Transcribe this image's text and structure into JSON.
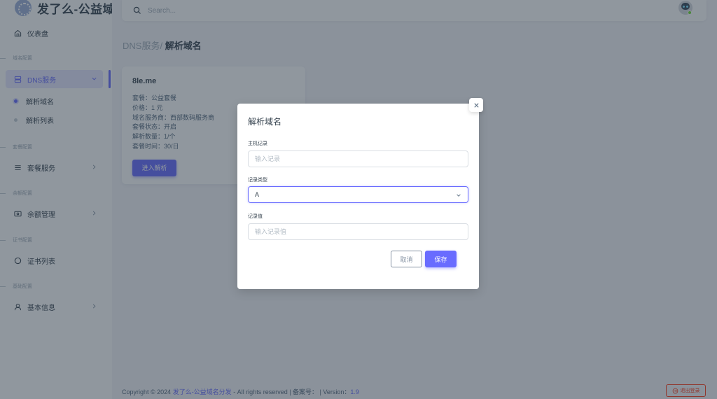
{
  "brand": {
    "name": "发了么-公益域"
  },
  "search": {
    "placeholder": "Search..."
  },
  "sidebar": {
    "dashboard": "仪表盘",
    "sections": [
      {
        "header": "域名配置"
      },
      {
        "header": "套餐配置"
      },
      {
        "header": "余额配置"
      },
      {
        "header": "证书配置"
      },
      {
        "header": "基础配置"
      }
    ],
    "dns_service": "DNS服务",
    "dns_sub": [
      "解析域名",
      "解析列表"
    ],
    "plan_service": "套餐服务",
    "balance": "余额管理",
    "certs": "证书列表",
    "basic_info": "基本信息"
  },
  "page": {
    "crumb": "DNS服务/",
    "title": "解析域名"
  },
  "plan_card": {
    "name": "8le.me",
    "lines": [
      "套餐：公益套餐",
      "价格：1 元",
      "域名服务商：西部数码服务商",
      "套餐状态：开启",
      "解析数量：1/个",
      "套餐时间：30/日"
    ],
    "button": "进入解析"
  },
  "modal": {
    "title": "解析域名",
    "host_label": "主机记录",
    "host_placeholder": "输入记录",
    "type_label": "记录类型",
    "type_value": "A",
    "value_label": "记录值",
    "value_placeholder": "输入记录值",
    "cancel": "取消",
    "save": "保存"
  },
  "footer": {
    "prefix": "Copyright © 2024 ",
    "link": "发了么-公益域名分发",
    "suffix": " - All rights reserved | 备案号：  | Version：",
    "version": "1.9"
  },
  "logout": "退出登录",
  "colors": {
    "primary": "#696cff",
    "danger": "#ff3e1d",
    "success": "#71dd37"
  },
  "icons": [
    "home-icon",
    "server-icon",
    "menu-icon",
    "wallet-icon",
    "circle-icon",
    "user-icon",
    "search-icon",
    "close-icon",
    "chevron-down-icon",
    "logout-icon"
  ]
}
